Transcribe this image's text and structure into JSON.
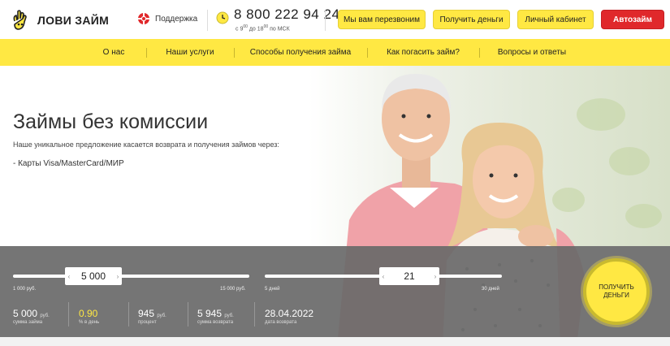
{
  "header": {
    "logo_text": "ЛОВИ ЗАЙМ",
    "support_label": "Поддержка",
    "phone": "8 800 222 94 24",
    "hours_prefix": "с 9",
    "hours_from_sup": "00",
    "hours_mid": " до 18",
    "hours_to_sup": "00",
    "hours_suffix": " по МСК",
    "buttons": {
      "callback": "Мы вам перезвоним",
      "get_money": "Получить деньги",
      "cabinet": "Личный кабинет",
      "autoloan": "Автозайм"
    },
    "colors": {
      "accent": "#ffe843",
      "danger": "#e0282b"
    }
  },
  "nav": {
    "items": [
      "О нас",
      "Наши услуги",
      "Способы получения займа",
      "Как погасить займ?",
      "Вопросы и ответы"
    ]
  },
  "hero": {
    "title": "Займы без комиссии",
    "subtitle": "Наше уникальное предложение касается возврата и получения займов через:",
    "bullet": "-   Карты Visa/MasterCard/МИР"
  },
  "calculator": {
    "amount": {
      "value": "5 000",
      "min_label": "1 000 руб.",
      "max_label": "15 000 руб.",
      "position": 0.28
    },
    "days": {
      "value": "21",
      "min_label": "5 дней",
      "max_label": "30 дней",
      "position": 0.65
    },
    "stats": {
      "loan_sum": {
        "value": "5 000",
        "unit": "руб.",
        "caption": "сумма займа"
      },
      "daily_rate": {
        "value": "0.90",
        "caption": "% в день"
      },
      "interest": {
        "value": "945",
        "unit": "руб.",
        "caption": "процент"
      },
      "return_sum": {
        "value": "5 945",
        "unit": "руб.",
        "caption": "сумма возврата"
      },
      "return_date": {
        "value": "28.04.2022",
        "caption": "дата возврата"
      }
    },
    "get_button_line1": "ПОЛУЧИТЬ",
    "get_button_line2": "ДЕНЬГИ"
  },
  "icons": {
    "logo": "hand-logo-icon",
    "support": "lifebuoy-icon",
    "clock": "clock-icon",
    "left_arrow": "chevron-left-icon",
    "right_arrow": "chevron-right-icon"
  }
}
